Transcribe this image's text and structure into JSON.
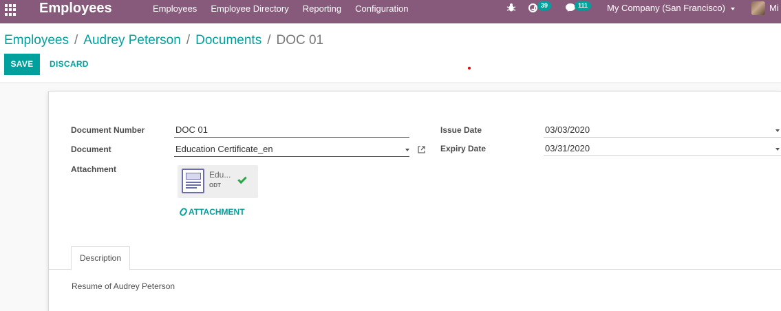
{
  "navbar": {
    "app_title": "Employees",
    "menu": [
      "Employees",
      "Employee Directory",
      "Reporting",
      "Configuration"
    ],
    "activity_count": "39",
    "message_count": "111",
    "company": "My Company (San Francisco)",
    "user_name_partial": "Mi"
  },
  "breadcrumb": {
    "items": [
      "Employees",
      "Audrey Peterson",
      "Documents"
    ],
    "current": "DOC 01",
    "separator": "/"
  },
  "buttons": {
    "save": "SAVE",
    "discard": "DISCARD"
  },
  "form": {
    "document_number_label": "Document Number",
    "document_number_value": "DOC 01",
    "document_label": "Document",
    "document_value": "Education Certificate_en",
    "attachment_label": "Attachment",
    "attachment_name": "Edu...",
    "attachment_ext": "ODT",
    "add_attachment": "ATTACHMENT",
    "issue_date_label": "Issue Date",
    "issue_date_value": "03/03/2020",
    "expiry_date_label": "Expiry Date",
    "expiry_date_value": "03/31/2020"
  },
  "tabs": {
    "active": "Description"
  },
  "description_text": "Resume of Audrey Peterson",
  "colors": {
    "navbar": "#875a7b",
    "accent": "#00a09d"
  }
}
